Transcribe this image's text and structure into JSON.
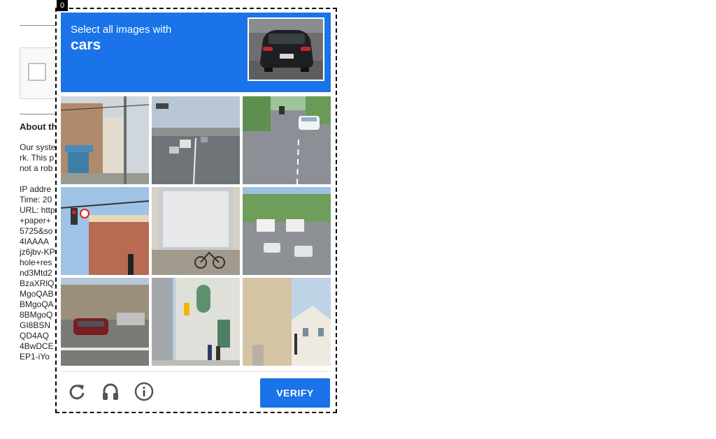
{
  "frame_tag": "0",
  "background": {
    "about_label": "About th",
    "lines": [
      "Our syste",
      "rk. This p",
      "not a rob",
      "",
      "IP addre",
      "Time: 20",
      "URL: http",
      "+paper+",
      "5725&so",
      "4IAAAA",
      "jz6jbv-KP",
      "hole+res",
      "nd3Mtd2",
      "BzaXRlQ",
      "MgoQAB",
      "BMgoQA",
      "8BMgoQ",
      "GI8BSN",
      "QD4AQ",
      "4BwDCE",
      "EP1-iYo"
    ]
  },
  "challenge": {
    "instruction": "Select all images with",
    "target": "cars",
    "sample_image": "rear view of a dark hatchback car",
    "tiles": [
      "street with buildings and awning",
      "highway with cars",
      "road with white car and motorbike",
      "traffic light at intersection",
      "bicycles in front of storefront",
      "street with buses and cars",
      "parked red car on street",
      "building with traffic light and pedestrians",
      "beige wall with street"
    ],
    "verify_label": "VERIFY",
    "icons": {
      "reload": "reload-icon",
      "audio": "headphones-icon",
      "info": "info-icon"
    },
    "accent_color": "#1a73e8"
  }
}
